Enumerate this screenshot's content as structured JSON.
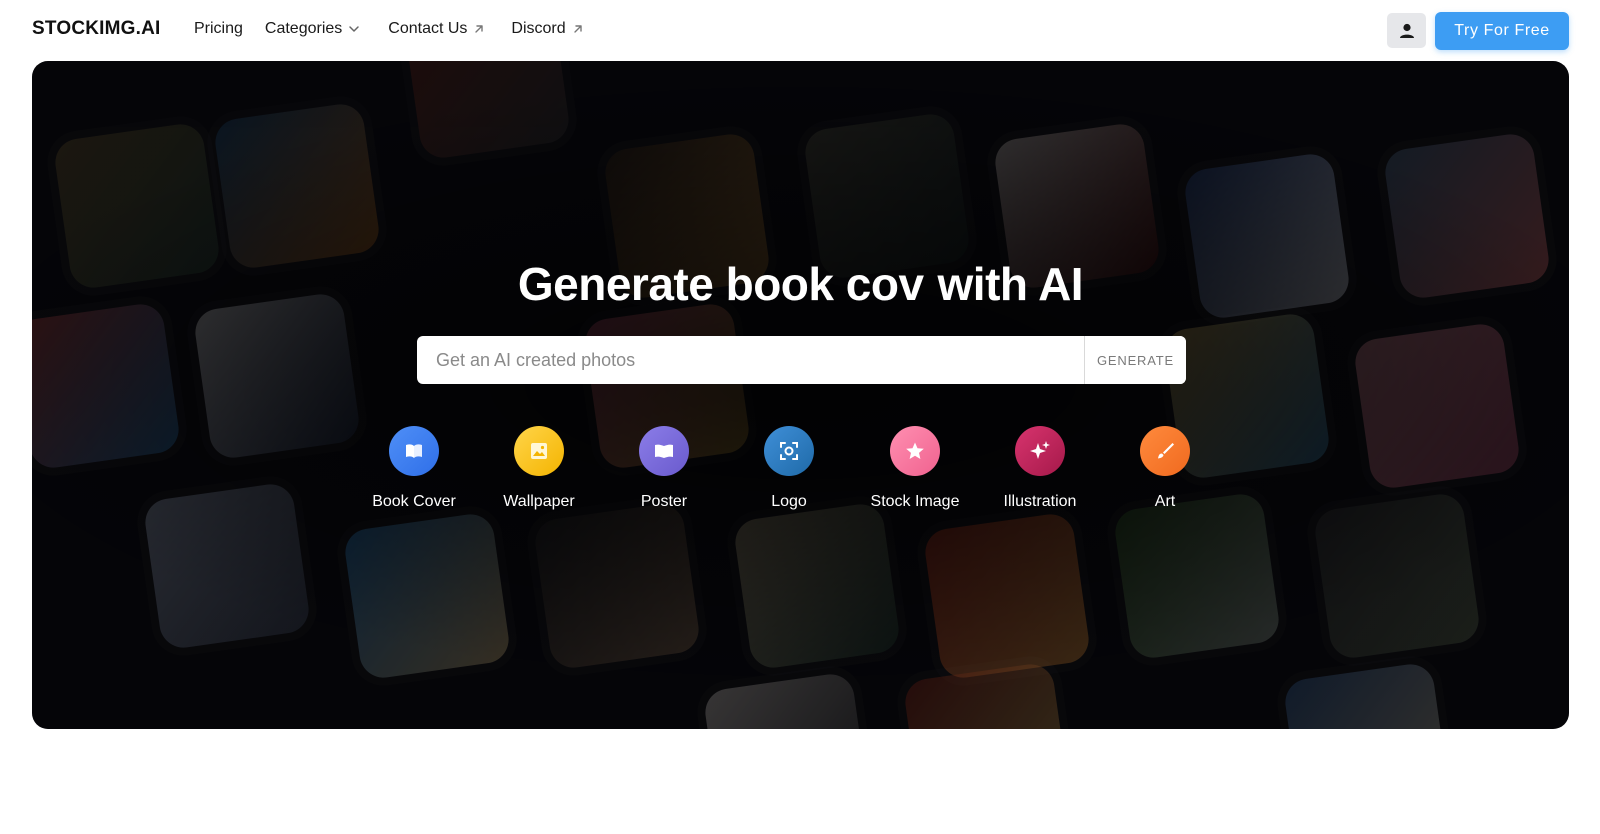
{
  "nav": {
    "brand": "STOCKIMG.AI",
    "links": [
      {
        "label": "Pricing"
      },
      {
        "label": "Categories",
        "icon": "chevron-down-icon"
      },
      {
        "label": "Contact Us",
        "icon": "external-link-icon"
      },
      {
        "label": "Discord",
        "icon": "external-link-icon"
      }
    ],
    "user_icon": "user-icon",
    "cta_label": "Try For Free"
  },
  "hero": {
    "headline_part1": "Generate book cov",
    "headline_part2": "with AI",
    "search": {
      "placeholder": "Get an AI created photos",
      "value": "",
      "button_label": "GENERATE"
    },
    "categories": [
      {
        "label": "Book Cover",
        "icon": "book-icon",
        "colors": [
          "#4f8ff7",
          "#2f6fe8"
        ]
      },
      {
        "label": "Wallpaper",
        "icon": "image-icon",
        "colors": [
          "#ffd54a",
          "#f4b400"
        ]
      },
      {
        "label": "Poster",
        "icon": "poster-icon",
        "colors": [
          "#8b7de8",
          "#6a5acd"
        ]
      },
      {
        "label": "Logo",
        "icon": "focus-icon",
        "colors": [
          "#3f8fd8",
          "#1f6aa8"
        ]
      },
      {
        "label": "Stock Image",
        "icon": "star-icon",
        "colors": [
          "#ff8fb1",
          "#f0628f"
        ]
      },
      {
        "label": "Illustration",
        "icon": "sparkles-icon",
        "colors": [
          "#d8346e",
          "#a5194a"
        ]
      },
      {
        "label": "Art",
        "icon": "brush-icon",
        "colors": [
          "#ff8a3d",
          "#f06a1f"
        ]
      }
    ]
  },
  "colors": {
    "cta": "#3d9df3",
    "hero_background": "#07070c"
  }
}
